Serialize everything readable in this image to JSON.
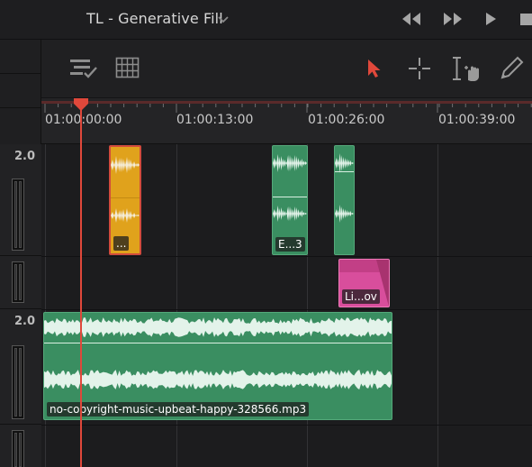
{
  "timeline": {
    "title": "TL - Generative Fill"
  },
  "ruler": {
    "timecodes": [
      "01:00:00:00",
      "01:00:13:00",
      "01:00:26:00",
      "01:00:39:00"
    ]
  },
  "tracks": {
    "header_labels": [
      "2.0",
      "2.0"
    ]
  },
  "clips": {
    "orange_label": "...",
    "green_e3_label": "E...3",
    "pink_label": "Li...ov",
    "music_label": "no-copyright-music-upbeat-happy-328566.mp3"
  },
  "icons": {
    "transport": [
      "rewind-icon",
      "fast-forward-icon",
      "play-icon",
      "stop-icon"
    ],
    "toolbar": [
      "timeline-options-icon",
      "grid-icon",
      "selection-arrow-icon",
      "crosshair-icon",
      "trim-hand-icon",
      "pen-icon"
    ]
  },
  "colors": {
    "playhead": "#e0483b",
    "audio_clip": "#3a8e61",
    "selected_clip": "#e0a21c",
    "pink_clip": "#d84e9c",
    "selection_tool": "#e0483b"
  }
}
